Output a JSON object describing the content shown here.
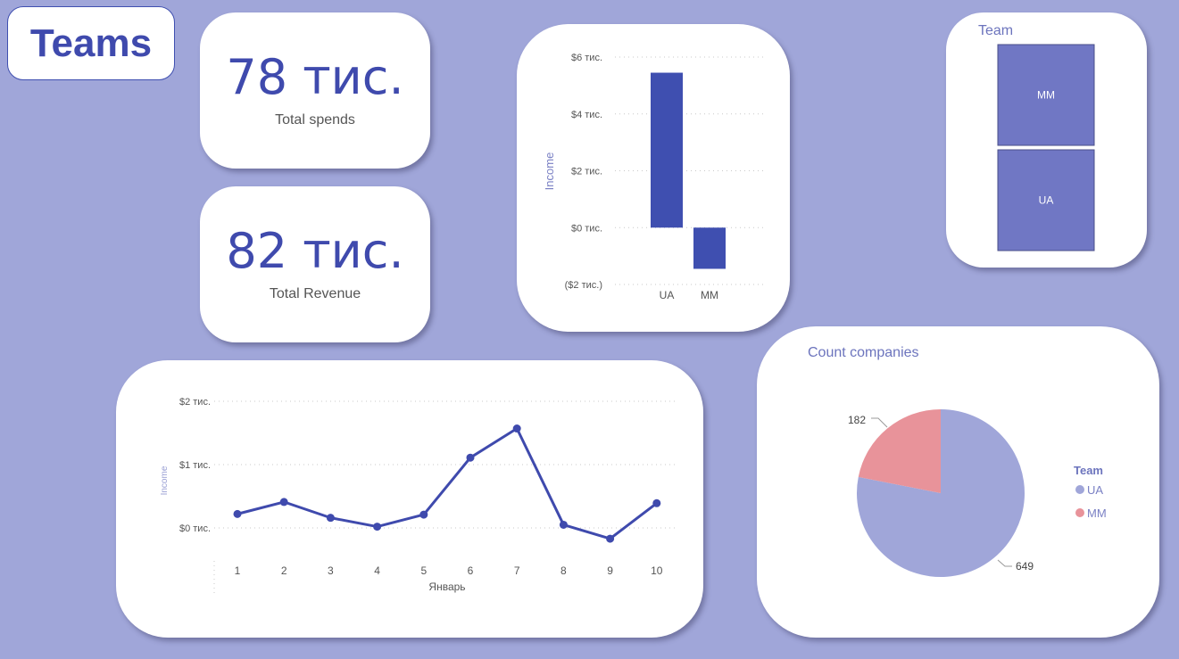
{
  "page_title": "Teams",
  "kpis": {
    "total_spends": {
      "value": "78 тис.",
      "label": "Total spends"
    },
    "total_revenue": {
      "value": "82 тис.",
      "label": "Total Revenue"
    }
  },
  "chart_data": [
    {
      "type": "bar",
      "ylabel": "Income",
      "categories": [
        "UA",
        "MM"
      ],
      "values": [
        5.45,
        -1.45
      ],
      "ylim": [
        -2,
        6
      ],
      "yticks": [
        {
          "value": 6,
          "label": "$6 тис."
        },
        {
          "value": 4,
          "label": "$4 тис."
        },
        {
          "value": 2,
          "label": "$2 тис."
        },
        {
          "value": 0,
          "label": "$0 тис."
        },
        {
          "value": -2,
          "label": "($2 тис.)"
        }
      ],
      "grid": true,
      "color": "#3f4fb0"
    },
    {
      "type": "table",
      "title": "Team",
      "items": [
        "MM",
        "UA"
      ],
      "color": "#7077c4"
    },
    {
      "type": "line",
      "ylabel": "Income",
      "xlabel": "Январь",
      "x": [
        1,
        2,
        3,
        4,
        5,
        6,
        7,
        8,
        9,
        10
      ],
      "values": [
        0.22,
        0.41,
        0.16,
        0.02,
        0.21,
        1.11,
        1.57,
        0.05,
        -0.17,
        0.39
      ],
      "ylim": [
        -0.5,
        2.2
      ],
      "yticks": [
        {
          "value": 2,
          "label": "$2 тис."
        },
        {
          "value": 1,
          "label": "$1 тис."
        },
        {
          "value": 0,
          "label": "$0 тис."
        }
      ],
      "grid": true,
      "color": "#3f4aad"
    },
    {
      "type": "pie",
      "title": "Count companies",
      "legend_title": "Team",
      "legend_position": "right",
      "slices": [
        {
          "name": "UA",
          "value": 649,
          "color": "#a0a6d9"
        },
        {
          "name": "MM",
          "value": 182,
          "color": "#e8939a"
        }
      ]
    }
  ]
}
